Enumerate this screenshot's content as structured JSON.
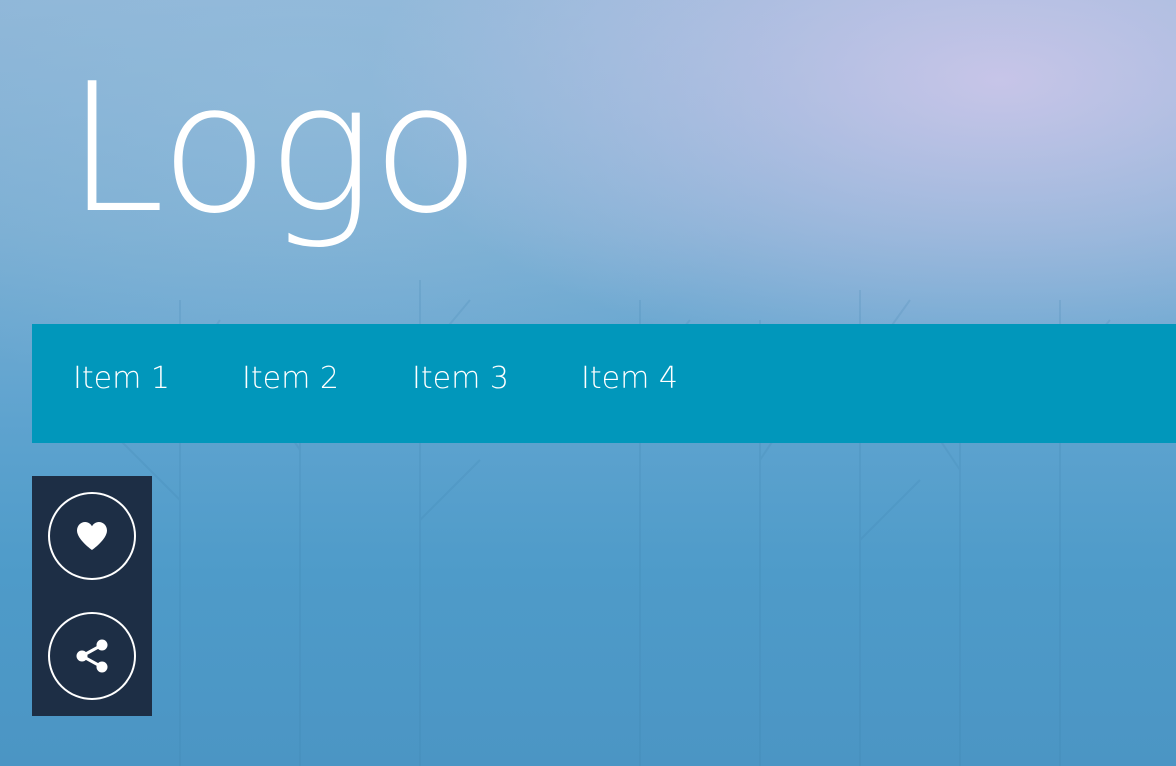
{
  "header": {
    "logo_text": "Logo"
  },
  "nav": {
    "items": [
      {
        "label": "Item 1"
      },
      {
        "label": "Item 2"
      },
      {
        "label": "Item 3"
      },
      {
        "label": "Item 4"
      }
    ]
  },
  "social": {
    "buttons": [
      {
        "icon": "heart-icon"
      },
      {
        "icon": "share-icon"
      }
    ]
  },
  "colors": {
    "nav_background": "#0197bb",
    "social_panel_background": "#1d2e45",
    "text": "#ffffff"
  }
}
